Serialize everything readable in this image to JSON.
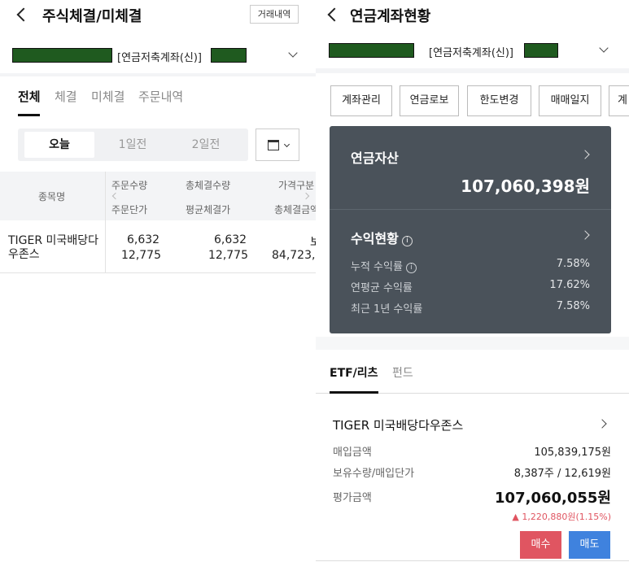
{
  "colors": {
    "mask": "#1f5a1f",
    "dark_card": "#4a525a",
    "buy": "#e05561",
    "sell": "#3f82de",
    "up": "#e05561"
  },
  "left": {
    "title": "주식체결/미체결",
    "history_btn": "거래내역",
    "account_label": "[연금저축계좌(신)]",
    "tabs": [
      "전체",
      "체결",
      "미체결",
      "주문내역"
    ],
    "periods": [
      "오늘",
      "1일전",
      "2일전"
    ],
    "table": {
      "col_name": "종목명",
      "col_qty_top": "주문수량",
      "col_qty_bottom": "주문단가",
      "col_filled_top": "총체결수량",
      "col_filled_bottom": "평균체결가",
      "col_price_top": "가격구분",
      "col_price_bottom": "총체결금액",
      "row": {
        "name": "TIGER 미국배당다우존스",
        "qty": "6,632",
        "unit_price": "12,775",
        "filled_qty": "6,632",
        "avg_price": "12,775",
        "price_type": "보",
        "total": "84,723,8"
      }
    }
  },
  "right": {
    "title": "연금계좌현황",
    "account_label": "[연금저축계좌(신)]",
    "buttons": [
      "계좌관리",
      "연금로보",
      "한도변경",
      "매매일지",
      "계"
    ],
    "assets_title": "연금자산",
    "assets_amount": "107,060,398원",
    "returns_title": "수익현황",
    "returns": [
      {
        "label": "누적 수익률",
        "value": "7.58%"
      },
      {
        "label": "연평균 수익률",
        "value": "17.62%"
      },
      {
        "label": "최근 1년 수익률",
        "value": "7.58%"
      }
    ],
    "tabs": [
      "ETF/리츠",
      "펀드"
    ],
    "holding": {
      "name": "TIGER 미국배당다우존스",
      "buy_amount_label": "매입금액",
      "buy_amount": "105,839,175원",
      "qty_label": "보유수량/매입단가",
      "qty_value": "8,387주 / 12,619원",
      "eval_label": "평가금액",
      "eval_amount": "107,060,055원",
      "delta": "▲ 1,220,880원(1.15%)"
    },
    "buy_label": "매수",
    "sell_label": "매도"
  }
}
